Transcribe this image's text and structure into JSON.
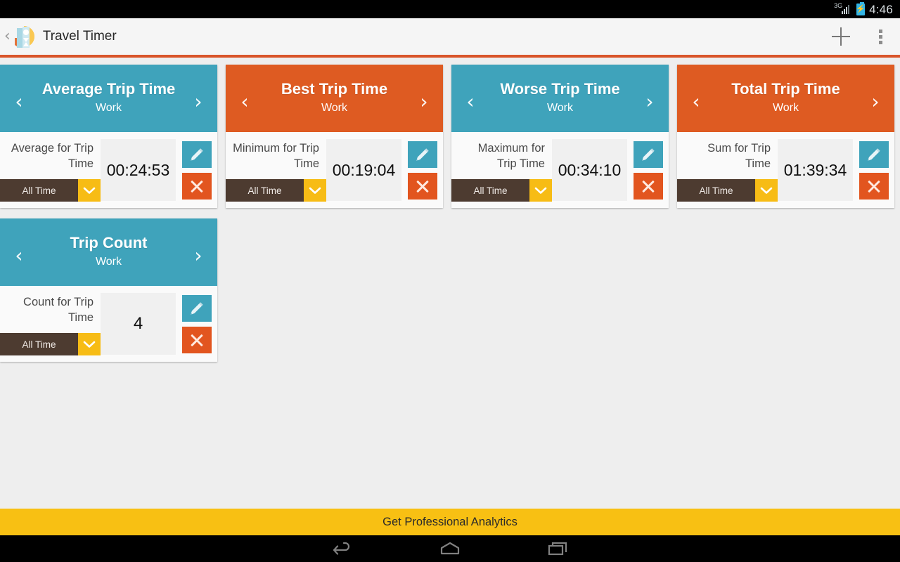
{
  "statusbar": {
    "network_label": "3G",
    "time": "4:46",
    "signal_icon": "signal-bars-icon",
    "battery_icon": "battery-charging-icon"
  },
  "actionbar": {
    "up_icon": "back-chevron-icon",
    "app_logo": "travel-timer-logo-icon",
    "title": "Travel Timer",
    "add_icon": "plus-icon",
    "overflow_icon": "overflow-menu-icon",
    "accent_rule_color": "#d9552a"
  },
  "colors": {
    "teal": "#3fa3bb",
    "orange": "#de5b22",
    "delete_orange": "#e2551f",
    "dropdown_brown": "#4d3b30",
    "dropdown_yellow": "#f7bc15",
    "banner_yellow": "#f8c013",
    "page_background": "#eeeeee"
  },
  "cards": [
    {
      "title": "Average Trip Time",
      "subtitle": "Work",
      "header_color": "teal",
      "prev_icon": "chevron-left-icon",
      "next_icon": "chevron-right-icon",
      "label": "Average for Trip Time",
      "range": "All Time",
      "range_caret_icon": "chevron-down-icon",
      "value": "00:24:53",
      "edit_icon": "pencil-icon",
      "delete_icon": "close-x-icon"
    },
    {
      "title": "Best Trip Time",
      "subtitle": "Work",
      "header_color": "orange",
      "prev_icon": "chevron-left-icon",
      "next_icon": "chevron-right-icon",
      "label": "Minimum for Trip Time",
      "range": "All Time",
      "range_caret_icon": "chevron-down-icon",
      "value": "00:19:04",
      "edit_icon": "pencil-icon",
      "delete_icon": "close-x-icon"
    },
    {
      "title": "Worse Trip Time",
      "subtitle": "Work",
      "header_color": "teal",
      "prev_icon": "chevron-left-icon",
      "next_icon": "chevron-right-icon",
      "label": "Maximum for Trip Time",
      "range": "All Time",
      "range_caret_icon": "chevron-down-icon",
      "value": "00:34:10",
      "edit_icon": "pencil-icon",
      "delete_icon": "close-x-icon"
    },
    {
      "title": "Total Trip Time",
      "subtitle": "Work",
      "header_color": "orange",
      "prev_icon": "chevron-left-icon",
      "next_icon": "chevron-right-icon",
      "label": "Sum for Trip Time",
      "range": "All Time",
      "range_caret_icon": "chevron-down-icon",
      "value": "01:39:34",
      "edit_icon": "pencil-icon",
      "delete_icon": "close-x-icon"
    },
    {
      "title": "Trip Count",
      "subtitle": "Work",
      "header_color": "teal",
      "prev_icon": "chevron-left-icon",
      "next_icon": "chevron-right-icon",
      "label": "Count for Trip Time",
      "range": "All Time",
      "range_caret_icon": "chevron-down-icon",
      "value": "4",
      "edit_icon": "pencil-icon",
      "delete_icon": "close-x-icon"
    }
  ],
  "banner": {
    "text": "Get Professional Analytics"
  },
  "navbar": {
    "back_icon": "nav-back-icon",
    "home_icon": "nav-home-icon",
    "recents_icon": "nav-recents-icon"
  }
}
